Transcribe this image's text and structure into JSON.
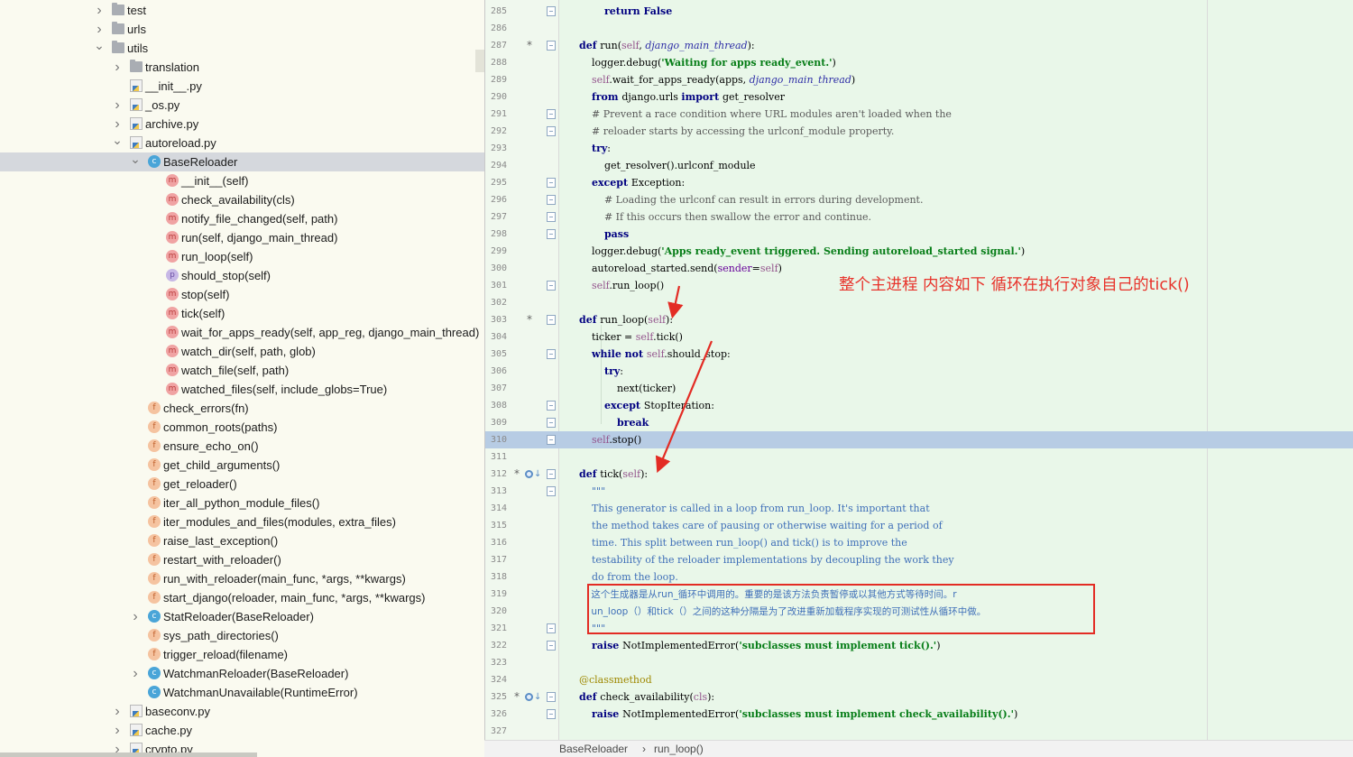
{
  "tree": {
    "items": [
      {
        "label": "test",
        "depth": 0,
        "arrow": "right",
        "icon": "folder"
      },
      {
        "label": "urls",
        "depth": 0,
        "arrow": "right",
        "icon": "folder"
      },
      {
        "label": "utils",
        "depth": 0,
        "arrow": "down",
        "icon": "folder"
      },
      {
        "label": "translation",
        "depth": 1,
        "arrow": "right",
        "icon": "folder"
      },
      {
        "label": "__init__.py",
        "depth": 1,
        "arrow": "",
        "icon": "py"
      },
      {
        "label": "_os.py",
        "depth": 1,
        "arrow": "right",
        "icon": "py"
      },
      {
        "label": "archive.py",
        "depth": 1,
        "arrow": "right",
        "icon": "py"
      },
      {
        "label": "autoreload.py",
        "depth": 1,
        "arrow": "down",
        "icon": "py"
      },
      {
        "label": "BaseReloader",
        "depth": 2,
        "arrow": "down",
        "icon": "c",
        "selected": true
      },
      {
        "label": "__init__(self)",
        "depth": 3,
        "arrow": "",
        "icon": "m"
      },
      {
        "label": "check_availability(cls)",
        "depth": 3,
        "arrow": "",
        "icon": "m"
      },
      {
        "label": "notify_file_changed(self, path)",
        "depth": 3,
        "arrow": "",
        "icon": "m"
      },
      {
        "label": "run(self, django_main_thread)",
        "depth": 3,
        "arrow": "",
        "icon": "m"
      },
      {
        "label": "run_loop(self)",
        "depth": 3,
        "arrow": "",
        "icon": "m"
      },
      {
        "label": "should_stop(self)",
        "depth": 3,
        "arrow": "",
        "icon": "p"
      },
      {
        "label": "stop(self)",
        "depth": 3,
        "arrow": "",
        "icon": "m"
      },
      {
        "label": "tick(self)",
        "depth": 3,
        "arrow": "",
        "icon": "m"
      },
      {
        "label": "wait_for_apps_ready(self, app_reg, django_main_thread)",
        "depth": 3,
        "arrow": "",
        "icon": "m"
      },
      {
        "label": "watch_dir(self, path, glob)",
        "depth": 3,
        "arrow": "",
        "icon": "m"
      },
      {
        "label": "watch_file(self, path)",
        "depth": 3,
        "arrow": "",
        "icon": "m"
      },
      {
        "label": "watched_files(self, include_globs=True)",
        "depth": 3,
        "arrow": "",
        "icon": "m"
      },
      {
        "label": "check_errors(fn)",
        "depth": 2,
        "arrow": "",
        "icon": "f"
      },
      {
        "label": "common_roots(paths)",
        "depth": 2,
        "arrow": "",
        "icon": "f"
      },
      {
        "label": "ensure_echo_on()",
        "depth": 2,
        "arrow": "",
        "icon": "f"
      },
      {
        "label": "get_child_arguments()",
        "depth": 2,
        "arrow": "",
        "icon": "f"
      },
      {
        "label": "get_reloader()",
        "depth": 2,
        "arrow": "",
        "icon": "f"
      },
      {
        "label": "iter_all_python_module_files()",
        "depth": 2,
        "arrow": "",
        "icon": "f"
      },
      {
        "label": "iter_modules_and_files(modules, extra_files)",
        "depth": 2,
        "arrow": "",
        "icon": "f"
      },
      {
        "label": "raise_last_exception()",
        "depth": 2,
        "arrow": "",
        "icon": "f"
      },
      {
        "label": "restart_with_reloader()",
        "depth": 2,
        "arrow": "",
        "icon": "f"
      },
      {
        "label": "run_with_reloader(main_func, *args, **kwargs)",
        "depth": 2,
        "arrow": "",
        "icon": "f"
      },
      {
        "label": "start_django(reloader, main_func, *args, **kwargs)",
        "depth": 2,
        "arrow": "",
        "icon": "f"
      },
      {
        "label": "StatReloader(BaseReloader)",
        "depth": 2,
        "arrow": "right",
        "icon": "c"
      },
      {
        "label": "sys_path_directories()",
        "depth": 2,
        "arrow": "",
        "icon": "f"
      },
      {
        "label": "trigger_reload(filename)",
        "depth": 2,
        "arrow": "",
        "icon": "f"
      },
      {
        "label": "WatchmanReloader(BaseReloader)",
        "depth": 2,
        "arrow": "right",
        "icon": "c"
      },
      {
        "label": "WatchmanUnavailable(RuntimeError)",
        "depth": 2,
        "arrow": "",
        "icon": "c"
      },
      {
        "label": "baseconv.py",
        "depth": 1,
        "arrow": "right",
        "icon": "py"
      },
      {
        "label": "cache.py",
        "depth": 1,
        "arrow": "right",
        "icon": "py"
      },
      {
        "label": "crypto.py",
        "depth": 1,
        "arrow": "right",
        "icon": "py"
      }
    ]
  },
  "editor": {
    "current_line": "310",
    "lines": [
      {
        "n": "285",
        "fold": true,
        "mark": "",
        "code": [
          [
            "        ",
            "pl"
          ],
          [
            "return ",
            "k"
          ],
          [
            "False",
            "k"
          ]
        ]
      },
      {
        "n": "286",
        "fold": false,
        "mark": "",
        "code": []
      },
      {
        "n": "287",
        "fold": true,
        "mark": "*",
        "code": [
          [
            "def ",
            "k"
          ],
          [
            "run(",
            "pl"
          ],
          [
            "self",
            "sl"
          ],
          [
            ", ",
            "pl"
          ],
          [
            "django_main_thread",
            "pr"
          ],
          [
            "):",
            "pl"
          ]
        ]
      },
      {
        "n": "288",
        "fold": false,
        "mark": "",
        "code": [
          [
            "    logger.debug(",
            "pl"
          ],
          [
            "'Waiting for apps ready_event.'",
            "st"
          ],
          [
            ")",
            "pl"
          ]
        ]
      },
      {
        "n": "289",
        "fold": false,
        "mark": "",
        "code": [
          [
            "    ",
            "pl"
          ],
          [
            "self",
            "sl"
          ],
          [
            ".wait_for_apps_ready(apps, ",
            "pl"
          ],
          [
            "django_main_thread",
            "pr"
          ],
          [
            ")",
            "pl"
          ]
        ]
      },
      {
        "n": "290",
        "fold": false,
        "mark": "",
        "code": [
          [
            "    ",
            "pl"
          ],
          [
            "from ",
            "k"
          ],
          [
            "django.urls ",
            "pl"
          ],
          [
            "import ",
            "k"
          ],
          [
            "get_resolver",
            "pl"
          ]
        ]
      },
      {
        "n": "291",
        "fold": true,
        "mark": "",
        "code": [
          [
            "    # Prevent a race condition where URL modules aren't loaded when the",
            "cm"
          ]
        ]
      },
      {
        "n": "292",
        "fold": true,
        "mark": "",
        "code": [
          [
            "    # reloader starts by accessing the urlconf_module property.",
            "cm"
          ]
        ]
      },
      {
        "n": "293",
        "fold": false,
        "mark": "",
        "code": [
          [
            "    ",
            "pl"
          ],
          [
            "try",
            "k"
          ],
          [
            ":",
            "pl"
          ]
        ]
      },
      {
        "n": "294",
        "fold": false,
        "mark": "",
        "code": [
          [
            "        get_resolver().urlconf_module",
            "pl"
          ]
        ]
      },
      {
        "n": "295",
        "fold": true,
        "mark": "",
        "code": [
          [
            "    ",
            "pl"
          ],
          [
            "except ",
            "k"
          ],
          [
            "Exception:",
            "pl"
          ]
        ]
      },
      {
        "n": "296",
        "fold": true,
        "mark": "",
        "code": [
          [
            "        # Loading the urlconf can result in errors during development.",
            "cm"
          ]
        ]
      },
      {
        "n": "297",
        "fold": true,
        "mark": "",
        "code": [
          [
            "        # If this occurs then swallow the error and continue.",
            "cm"
          ]
        ]
      },
      {
        "n": "298",
        "fold": true,
        "mark": "",
        "code": [
          [
            "        ",
            "pl"
          ],
          [
            "pass",
            "k"
          ]
        ]
      },
      {
        "n": "299",
        "fold": false,
        "mark": "",
        "code": [
          [
            "    logger.debug(",
            "pl"
          ],
          [
            "'Apps ready_event triggered. Sending autoreload_started signal.'",
            "st"
          ],
          [
            ")",
            "pl"
          ]
        ]
      },
      {
        "n": "300",
        "fold": false,
        "mark": "",
        "code": [
          [
            "    autoreload_started.send(",
            "pl"
          ],
          [
            "sender",
            "kw"
          ],
          [
            "=",
            "pl"
          ],
          [
            "self",
            "sl"
          ],
          [
            ")",
            "pl"
          ]
        ]
      },
      {
        "n": "301",
        "fold": true,
        "mark": "",
        "code": [
          [
            "    ",
            "pl"
          ],
          [
            "self",
            "sl"
          ],
          [
            ".run_loop()",
            "pl"
          ]
        ]
      },
      {
        "n": "302",
        "fold": false,
        "mark": "",
        "code": []
      },
      {
        "n": "303",
        "fold": true,
        "mark": "*",
        "code": [
          [
            "def ",
            "k"
          ],
          [
            "run_loop(",
            "pl"
          ],
          [
            "self",
            "sl"
          ],
          [
            "):",
            "pl"
          ]
        ]
      },
      {
        "n": "304",
        "fold": false,
        "mark": "",
        "code": [
          [
            "    ticker = ",
            "pl"
          ],
          [
            "self",
            "sl"
          ],
          [
            ".tick()",
            "pl"
          ]
        ]
      },
      {
        "n": "305",
        "fold": true,
        "mark": "",
        "code": [
          [
            "    ",
            "pl"
          ],
          [
            "while not ",
            "k"
          ],
          [
            "self",
            "sl"
          ],
          [
            ".should_stop:",
            "pl"
          ]
        ]
      },
      {
        "n": "306",
        "fold": false,
        "mark": "",
        "code": [
          [
            "        ",
            "pl"
          ],
          [
            "try",
            "k"
          ],
          [
            ":",
            "pl"
          ]
        ]
      },
      {
        "n": "307",
        "fold": false,
        "mark": "",
        "code": [
          [
            "            next(ticker)",
            "pl"
          ]
        ]
      },
      {
        "n": "308",
        "fold": true,
        "mark": "",
        "code": [
          [
            "        ",
            "pl"
          ],
          [
            "except ",
            "k"
          ],
          [
            "StopIteration:",
            "pl"
          ]
        ]
      },
      {
        "n": "309",
        "fold": true,
        "mark": "",
        "code": [
          [
            "            ",
            "pl"
          ],
          [
            "break",
            "k"
          ]
        ]
      },
      {
        "n": "310",
        "fold": true,
        "mark": "",
        "code": [
          [
            "    ",
            "pl"
          ],
          [
            "self",
            "sl"
          ],
          [
            ".stop()",
            "pl"
          ]
        ]
      },
      {
        "n": "311",
        "fold": false,
        "mark": "",
        "code": []
      },
      {
        "n": "312",
        "fold": true,
        "mark": "*o",
        "code": [
          [
            "def ",
            "k"
          ],
          [
            "tick(",
            "pl"
          ],
          [
            "self",
            "sl"
          ],
          [
            "):",
            "pl"
          ]
        ]
      },
      {
        "n": "313",
        "fold": true,
        "mark": "",
        "code": [
          [
            "    \"\"\"",
            "ds"
          ]
        ]
      },
      {
        "n": "314",
        "fold": false,
        "mark": "",
        "code": [
          [
            "    This generator is called in a loop from run_loop. It's important that",
            "ds"
          ]
        ]
      },
      {
        "n": "315",
        "fold": false,
        "mark": "",
        "code": [
          [
            "    the method takes care of pausing or otherwise waiting for a period of",
            "ds"
          ]
        ]
      },
      {
        "n": "316",
        "fold": false,
        "mark": "",
        "code": [
          [
            "    time. This split between run_loop() and tick() is to improve the",
            "ds"
          ]
        ]
      },
      {
        "n": "317",
        "fold": false,
        "mark": "",
        "code": [
          [
            "    testability of the reloader implementations by decoupling the work they",
            "ds"
          ]
        ]
      },
      {
        "n": "318",
        "fold": false,
        "mark": "",
        "code": [
          [
            "    do from the loop.",
            "ds"
          ]
        ]
      },
      {
        "n": "319",
        "fold": false,
        "mark": "",
        "code": [
          [
            "    这个生成器是从run_循环中调用的。重要的是该方法负责暂停或以其他方式等待时间。r",
            "ds cjk"
          ]
        ]
      },
      {
        "n": "320",
        "fold": false,
        "mark": "",
        "code": [
          [
            "    un_loop（）和tick（）之间的这种分隔是为了改进重新加载程序实现的可测试性从循环中做。",
            "ds cjk"
          ]
        ]
      },
      {
        "n": "321",
        "fold": true,
        "mark": "",
        "code": [
          [
            "    \"\"\"",
            "ds"
          ]
        ]
      },
      {
        "n": "322",
        "fold": true,
        "mark": "",
        "code": [
          [
            "    ",
            "pl"
          ],
          [
            "raise ",
            "k"
          ],
          [
            "NotImplementedError(",
            "pl"
          ],
          [
            "'subclasses must implement tick().'",
            "st"
          ],
          [
            ")",
            "pl"
          ]
        ]
      },
      {
        "n": "323",
        "fold": false,
        "mark": "",
        "code": []
      },
      {
        "n": "324",
        "fold": false,
        "mark": "",
        "code": [
          [
            "@classmethod",
            "dc"
          ]
        ]
      },
      {
        "n": "325",
        "fold": true,
        "mark": "*o",
        "code": [
          [
            "def ",
            "k"
          ],
          [
            "check_availability(",
            "pl"
          ],
          [
            "cls",
            "sl"
          ],
          [
            "):",
            "pl"
          ]
        ]
      },
      {
        "n": "326",
        "fold": true,
        "mark": "",
        "code": [
          [
            "    ",
            "pl"
          ],
          [
            "raise ",
            "k"
          ],
          [
            "NotImplementedError(",
            "pl"
          ],
          [
            "'subclasses must implement check_availability().'",
            "st"
          ],
          [
            ")",
            "pl"
          ]
        ]
      },
      {
        "n": "327",
        "fold": false,
        "mark": "",
        "code": []
      }
    ]
  },
  "annotation": {
    "note": "整个主进程 内容如下 循环在执行对象自己的tick()",
    "color": "#e8332b"
  },
  "breadcrumb": {
    "items": [
      "BaseReloader",
      "run_loop()"
    ],
    "separator": "›"
  }
}
